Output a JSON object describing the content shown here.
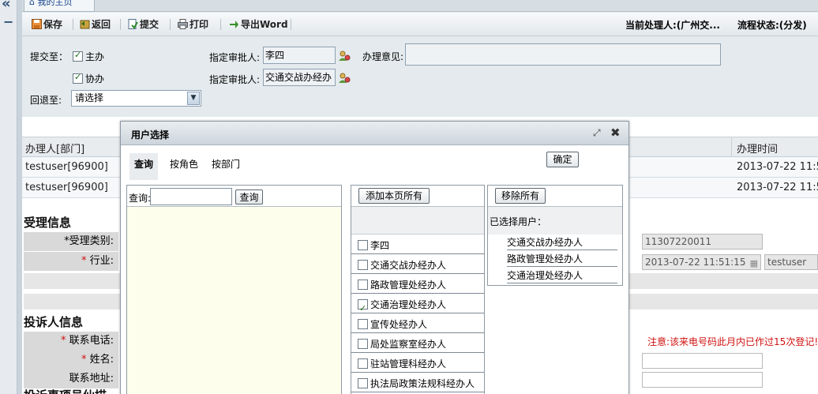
{
  "home_tab": "我的主页",
  "toolbar": {
    "save": "保存",
    "back": "返回",
    "submit": "提交",
    "print": "打印",
    "export": "导出Word",
    "handler": "当前处理人:(广州交...",
    "status": "流程状态:(分发)"
  },
  "form": {
    "submit_to_label": "提交至：",
    "main_label": "主办",
    "assist_label": "协办",
    "approver_label_1": "指定审批人:",
    "approver_value_1": "李四",
    "approver_label_2": "指定审批人:",
    "approver_value_2": "交通交战办经办",
    "opinion_label": "办理意见:",
    "return_label": "回退至:",
    "return_select": "请选择"
  },
  "grid": {
    "col_handler": "办理人[部门]",
    "col_time": "办理时间",
    "rows": [
      {
        "handler": "testuser[96900]",
        "time": "2013-07-22 11:5"
      },
      {
        "handler": "testuser[96900]",
        "time": "2013-07-22 11:5"
      }
    ]
  },
  "accept": {
    "title": "受理信息",
    "type_label": "*受理类别:",
    "industry_label": "行业:",
    "number": "11307220011",
    "datetime": "2013-07-22 11:51:15",
    "user": "testuser"
  },
  "complainant": {
    "title": "投诉人信息",
    "phone_label": "联系电话:",
    "name_label": "姓名:",
    "address_label": "联系地址:",
    "warning": "注意:该来电号码此月内已作过15次登记!",
    "cut_title": "投诉事项员仙描"
  },
  "dialog": {
    "title": "用户选择",
    "tabs": [
      "查询",
      "按角色",
      "按部门"
    ],
    "confirm": "确定",
    "query_label": "查询:",
    "query_button": "查询",
    "add_all": "添加本页所有",
    "remove_all": "移除所有",
    "selected_label": "已选择用户：",
    "users": [
      {
        "name": "李四",
        "checked": false
      },
      {
        "name": "交通交战办经办人",
        "checked": false
      },
      {
        "name": "路政管理处经办人",
        "checked": false
      },
      {
        "name": "交通治理处经办人",
        "checked": true
      },
      {
        "name": "宣传处经办人",
        "checked": false
      },
      {
        "name": "局处监察室经办人",
        "checked": false
      },
      {
        "name": "驻站管理科经办人",
        "checked": false
      },
      {
        "name": "执法局政策法规科经办人",
        "checked": false
      }
    ],
    "selected": [
      "交通交战办经办人",
      "路政管理处经办人",
      "交通治理处经办人"
    ]
  },
  "colors": {
    "accent": "#15428b",
    "required": "#d01010",
    "search_bg": "#fdfeec"
  }
}
